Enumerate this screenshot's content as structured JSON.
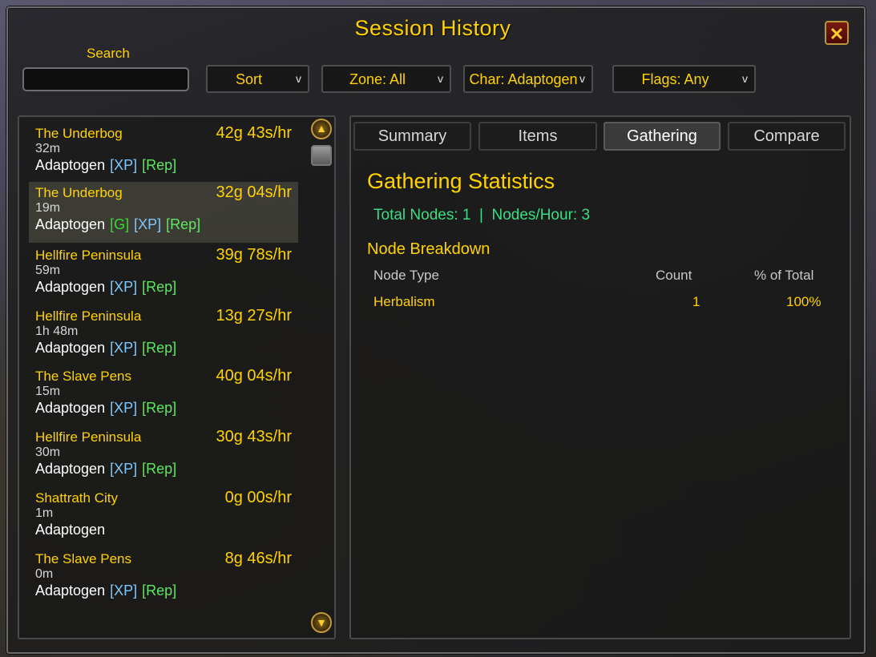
{
  "window": {
    "title": "Session History",
    "close_symbol": "✕"
  },
  "search": {
    "label": "Search",
    "value": ""
  },
  "filters": [
    {
      "label": "Sort"
    },
    {
      "label": "Zone: All"
    },
    {
      "label": "Char: Adaptogen"
    },
    {
      "label": "Flags: Any"
    }
  ],
  "dropdown_arrow": "v",
  "sessions": [
    {
      "zone": "The Underbog",
      "rate": "42g 43s/hr",
      "duration": "32m",
      "char": "Adaptogen",
      "tags": [
        "[XP]",
        "[Rep]"
      ]
    },
    {
      "zone": "The Underbog",
      "rate": "32g 04s/hr",
      "duration": "19m",
      "char": "Adaptogen",
      "tags": [
        "[G]",
        "[XP]",
        "[Rep]"
      ],
      "selected": true
    },
    {
      "zone": "Hellfire Peninsula",
      "rate": "39g 78s/hr",
      "duration": "59m",
      "char": "Adaptogen",
      "tags": [
        "[XP]",
        "[Rep]"
      ]
    },
    {
      "zone": "Hellfire Peninsula",
      "rate": "13g 27s/hr",
      "duration": "1h 48m",
      "char": "Adaptogen",
      "tags": [
        "[XP]",
        "[Rep]"
      ]
    },
    {
      "zone": "The Slave Pens",
      "rate": "40g 04s/hr",
      "duration": "15m",
      "char": "Adaptogen",
      "tags": [
        "[XP]",
        "[Rep]"
      ]
    },
    {
      "zone": "Hellfire Peninsula",
      "rate": "30g 43s/hr",
      "duration": "30m",
      "char": "Adaptogen",
      "tags": [
        "[XP]",
        "[Rep]"
      ]
    },
    {
      "zone": "Shattrath City",
      "rate": "0g 00s/hr",
      "duration": "1m",
      "char": "Adaptogen",
      "tags": []
    },
    {
      "zone": "The Slave Pens",
      "rate": "8g 46s/hr",
      "duration": "0m",
      "char": "Adaptogen",
      "tags": [
        "[XP]",
        "[Rep]"
      ]
    }
  ],
  "tabs": [
    {
      "label": "Summary"
    },
    {
      "label": "Items"
    },
    {
      "label": "Gathering",
      "active": true
    },
    {
      "label": "Compare"
    }
  ],
  "gathering": {
    "title": "Gathering Statistics",
    "stats_line": "Total Nodes: 1  |  Nodes/Hour: 3",
    "breakdown_title": "Node Breakdown",
    "columns": [
      "Node Type",
      "Count",
      "% of Total"
    ],
    "rows": [
      {
        "type": "Herbalism",
        "count": "1",
        "percent": "100%"
      }
    ]
  },
  "colors": {
    "gold": "#ffd200",
    "stat_green": "#3ddc84",
    "xp_tag": "#7ec8ff",
    "rep_tag": "#5ee85e",
    "g_tag": "#33dd33"
  }
}
